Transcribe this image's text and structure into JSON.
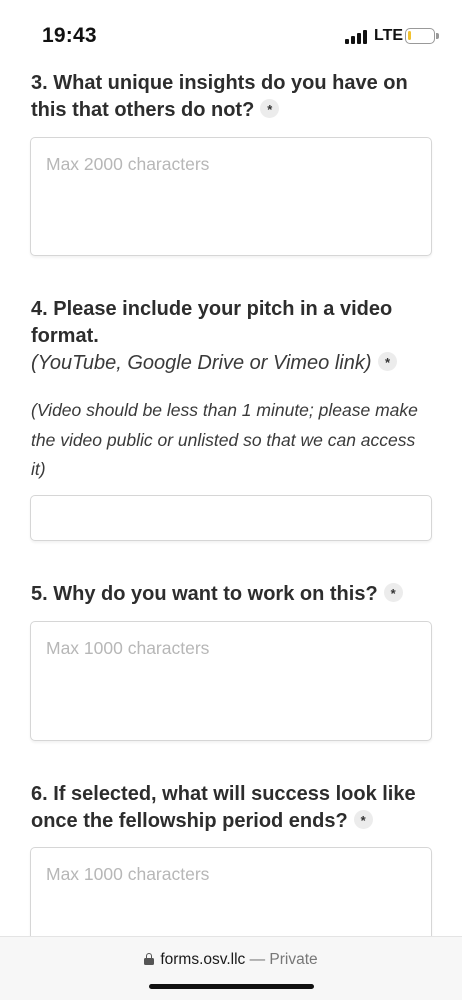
{
  "status_bar": {
    "time": "19:43",
    "network": "LTE",
    "battery_level": 0.15
  },
  "form": {
    "q3": {
      "title": "3. What unique insights do you have on this that others do not?",
      "required_mark": "*",
      "placeholder": "Max 2000 characters"
    },
    "q4": {
      "title": "4. Please include your pitch in a video format.",
      "subtitle": "(YouTube, Google Drive or Vimeo link)",
      "required_mark": "*",
      "note": "(Video should be less than 1 minute; please make the video public or unlisted so that we can access it)",
      "value": ""
    },
    "q5": {
      "title": "5. Why do you want to work on this?",
      "required_mark": "*",
      "placeholder": "Max 1000 characters"
    },
    "q6": {
      "title": "6. If selected, what will success look like once the fellowship period ends?",
      "required_mark": "*",
      "placeholder": "Max 1000 characters"
    }
  },
  "url_bar": {
    "domain": "forms.osv.llc",
    "separator": "—",
    "privacy": "Private"
  }
}
